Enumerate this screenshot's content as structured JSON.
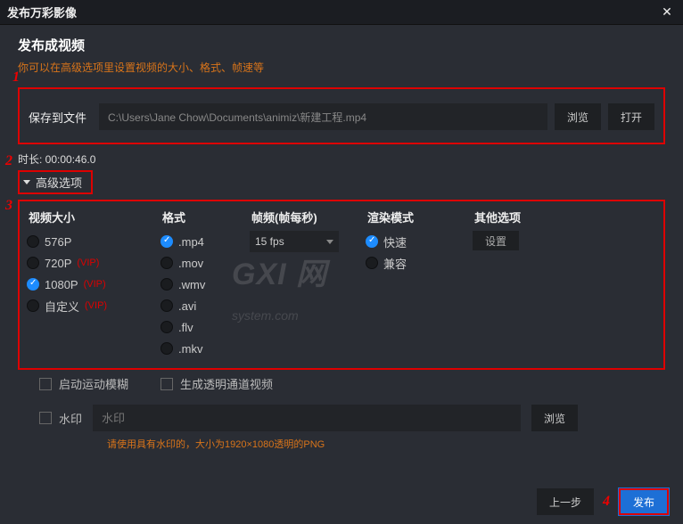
{
  "titlebar": {
    "title": "发布万彩影像"
  },
  "markers": {
    "m1": "1",
    "m2": "2",
    "m3": "3",
    "m4": "4"
  },
  "header": {
    "title": "发布成视频",
    "subtitle": "你可以在高级选项里设置视频的大小、格式、帧速等"
  },
  "save": {
    "label": "保存到文件",
    "path": "C:\\Users\\Jane Chow\\Documents\\animiz\\新建工程.mp4",
    "browse": "浏览",
    "open": "打开"
  },
  "duration": {
    "label": "时长: 00:00:46.0"
  },
  "advanced": {
    "label": "高级选项"
  },
  "columns": {
    "size": "视频大小",
    "format": "格式",
    "fps": "帧频(帧每秒)",
    "render": "渲染模式",
    "other": "其他选项"
  },
  "sizes": [
    {
      "label": "576P",
      "vip": "",
      "checked": false
    },
    {
      "label": "720P",
      "vip": "(VIP)",
      "checked": false
    },
    {
      "label": "1080P",
      "vip": "(VIP)",
      "checked": true
    },
    {
      "label": "自定义",
      "vip": "(VIP)",
      "checked": false
    }
  ],
  "formats": [
    {
      "label": ".mp4",
      "checked": true
    },
    {
      "label": ".mov",
      "checked": false
    },
    {
      "label": ".wmv",
      "checked": false
    },
    {
      "label": ".avi",
      "checked": false
    },
    {
      "label": ".flv",
      "checked": false
    },
    {
      "label": ".mkv",
      "checked": false
    }
  ],
  "fps": {
    "value": "15 fps"
  },
  "render": [
    {
      "label": "快速",
      "checked": true
    },
    {
      "label": "兼容",
      "checked": false
    }
  ],
  "other": {
    "settings": "设置"
  },
  "below": {
    "motion_blur": "启动运动模糊",
    "alpha": "生成透明通道视频",
    "watermark_label": "水印",
    "watermark_placeholder": "水印",
    "browse": "浏览",
    "hint": "请使用具有水印的，大小为1920×1080透明的PNG"
  },
  "footer": {
    "prev": "上一步",
    "publish": "发布"
  },
  "bg_watermark": {
    "big": "GX",
    "small": "I 网",
    "sub": "system.com"
  }
}
